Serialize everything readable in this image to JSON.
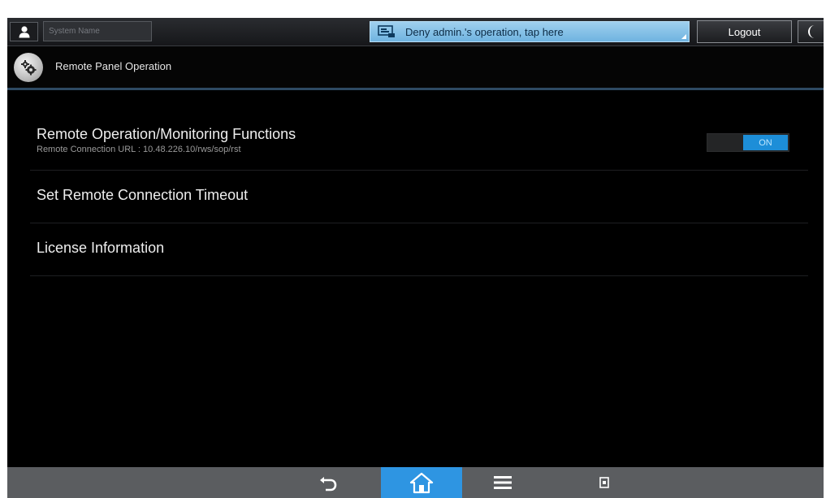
{
  "topbar": {
    "user_name": "System Name",
    "deny_label": "Deny admin.'s operation, tap here",
    "logout_label": "Logout",
    "icons": {
      "user": "user-icon",
      "deny": "remote-screen-icon",
      "energy": "moon-icon"
    }
  },
  "title": {
    "text": "Remote Panel Operation",
    "icon": "gear-icon"
  },
  "items": [
    {
      "title": "Remote Operation/Monitoring Functions",
      "subtitle": "Remote Connection URL : 10.48.226.10/rws/sop/rst",
      "toggle_label": "ON",
      "toggle_state": "on"
    },
    {
      "title": "Set Remote Connection Timeout"
    },
    {
      "title": "License Information"
    }
  ],
  "bottom_nav": {
    "icons": [
      "back-arrow-icon",
      "home-icon",
      "menu-icon",
      "stop-icon"
    ],
    "active": "home-icon"
  },
  "colors": {
    "accent": "#1d8ed8",
    "home_active": "#2e95e2",
    "deny_button": "#8dc6ea",
    "background": "#000000",
    "bottom_bar": "#5b5d60"
  }
}
